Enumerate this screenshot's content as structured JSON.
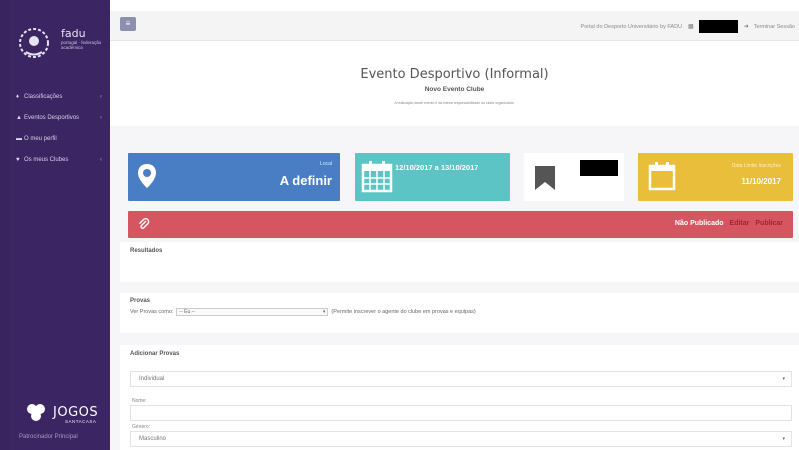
{
  "sidebar": {
    "logo_text": "fadu",
    "logo_sub": "portugal · federação académica",
    "items": [
      {
        "label": "Classificações",
        "icon": "trophy-icon"
      },
      {
        "label": "Eventos Desportivos",
        "icon": "event-icon"
      },
      {
        "label": "O meu perfil",
        "icon": "profile-icon"
      },
      {
        "label": "Os meus Clubes",
        "icon": "club-icon"
      }
    ],
    "sponsor_name": "JOGOS",
    "sponsor_sub": "SANTACASA",
    "sponsor_caption": "Patrocinador Principal"
  },
  "topbar": {
    "portal_link": "Portal do Desporto Universitário by FADU",
    "logout": "Terminar Sessão"
  },
  "header": {
    "title": "Evento Desportivo (Informal)",
    "subtitle": "Novo Evento Clube",
    "note": "A realização deste evento é da inteira responsabilidade do clube organizador."
  },
  "cards": {
    "local_label": "Local",
    "local_value": "A definir",
    "date_range": "12/10/2017 a 13/10/2017",
    "limit_label": "Data Limite Inscrições",
    "limit_value": "11/10/2017"
  },
  "status": {
    "unpublished": "Não Publicado",
    "edit": "Editar",
    "publish": "Publicar"
  },
  "sections": {
    "results_title": "Resultados",
    "provas_title": "Provas",
    "provas_label": "Ver Provas como:",
    "provas_select": "-- Eu --",
    "provas_hint": "(Permite inscrever o agente do clube em provas e equipas)",
    "add_title": "Adicionar Provas",
    "type_value": "Individual",
    "name_label": "Nome:",
    "gender_label": "Género:",
    "gender_value": "Masculino"
  },
  "colors": {
    "sidebar": "#3b2563",
    "local_card": "#4a7ec4",
    "date_card": "#5cc4c4",
    "limit_card": "#e9be3a",
    "status_bar": "#d55561"
  }
}
